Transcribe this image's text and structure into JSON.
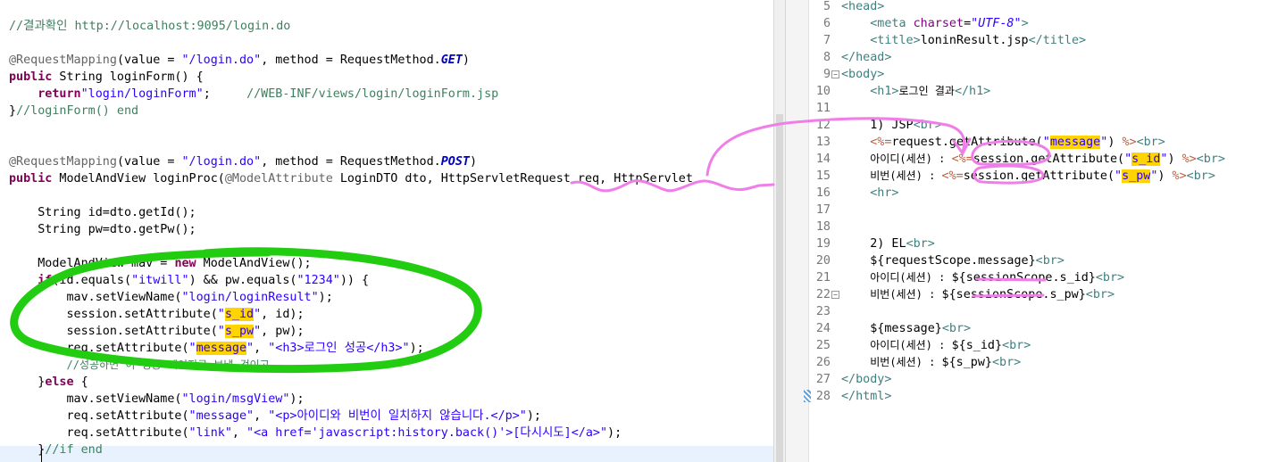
{
  "left_editor": {
    "lines": [
      {
        "t": 20,
        "segments": [
          {
            "c": "cm",
            "text": "//결과확인 http://localhost:9095/login.do"
          }
        ]
      },
      {
        "t": 58,
        "segments": [
          {
            "c": "an",
            "text": "@RequestMapping"
          },
          {
            "c": "",
            "text": "(value = "
          },
          {
            "c": "st",
            "text": "\"/login.do\""
          },
          {
            "c": "",
            "text": ", method = RequestMethod."
          },
          {
            "c": "it",
            "text": "GET"
          },
          {
            "c": "",
            "text": ")"
          }
        ]
      },
      {
        "t": 77,
        "segments": [
          {
            "c": "kw",
            "text": "public"
          },
          {
            "c": "",
            "text": " String loginForm() {"
          }
        ]
      },
      {
        "t": 96,
        "segments": [
          {
            "c": "",
            "text": "    "
          },
          {
            "c": "kw",
            "text": "return"
          },
          {
            "c": "st",
            "text": "\"login/loginForm\""
          },
          {
            "c": "",
            "text": ";     "
          },
          {
            "c": "cm",
            "text": "//WEB-INF/views/login/loginForm.jsp"
          }
        ]
      },
      {
        "t": 115,
        "segments": [
          {
            "c": "",
            "text": "}"
          },
          {
            "c": "cm",
            "text": "//loginForm() end"
          }
        ]
      },
      {
        "t": 172,
        "segments": [
          {
            "c": "an",
            "text": "@RequestMapping"
          },
          {
            "c": "",
            "text": "(value = "
          },
          {
            "c": "st",
            "text": "\"/login.do\""
          },
          {
            "c": "",
            "text": ", method = RequestMethod."
          },
          {
            "c": "it",
            "text": "POST"
          },
          {
            "c": "",
            "text": ")"
          }
        ]
      },
      {
        "t": 191,
        "segments": [
          {
            "c": "kw",
            "text": "public"
          },
          {
            "c": "",
            "text": " ModelAndView loginProc("
          },
          {
            "c": "an",
            "text": "@ModelAttribute"
          },
          {
            "c": "",
            "text": " LoginDTO dto, HttpServletRequest req, HttpServlet"
          }
        ]
      },
      {
        "t": 229,
        "segments": [
          {
            "c": "",
            "text": "    String id=dto.getId();"
          }
        ]
      },
      {
        "t": 248,
        "segments": [
          {
            "c": "",
            "text": "    String pw=dto.getPw();"
          }
        ]
      },
      {
        "t": 286,
        "segments": [
          {
            "c": "",
            "text": "    ModelAndView mav = "
          },
          {
            "c": "kw",
            "text": "new"
          },
          {
            "c": "",
            "text": " ModelAndView();"
          }
        ]
      },
      {
        "t": 305,
        "segments": [
          {
            "c": "",
            "text": "    "
          },
          {
            "c": "kw",
            "text": "if"
          },
          {
            "c": "",
            "text": "(id.equals("
          },
          {
            "c": "st",
            "text": "\"itwill\""
          },
          {
            "c": "",
            "text": ") && pw.equals("
          },
          {
            "c": "st",
            "text": "\"1234\""
          },
          {
            "c": "",
            "text": ")) {"
          }
        ]
      },
      {
        "t": 324,
        "segments": [
          {
            "c": "",
            "text": "        mav.setViewName("
          },
          {
            "c": "st",
            "text": "\"login/loginResult\""
          },
          {
            "c": "",
            "text": ");"
          }
        ]
      },
      {
        "t": 343,
        "segments": [
          {
            "c": "",
            "text": "        session.setAttribute("
          },
          {
            "c": "st",
            "text": "\""
          },
          {
            "c": "st hl",
            "text": "s_id"
          },
          {
            "c": "st",
            "text": "\""
          },
          {
            "c": "",
            "text": ", id);"
          }
        ]
      },
      {
        "t": 362,
        "segments": [
          {
            "c": "",
            "text": "        session.setAttribute("
          },
          {
            "c": "st",
            "text": "\""
          },
          {
            "c": "st hl",
            "text": "s_pw"
          },
          {
            "c": "st",
            "text": "\""
          },
          {
            "c": "",
            "text": ", pw);"
          }
        ]
      },
      {
        "t": 381,
        "segments": [
          {
            "c": "",
            "text": "        req.setAttribute("
          },
          {
            "c": "st",
            "text": "\""
          },
          {
            "c": "st hl",
            "text": "message"
          },
          {
            "c": "st",
            "text": "\""
          },
          {
            "c": "",
            "text": ", "
          },
          {
            "c": "st",
            "text": "\"<h3>로그인 성공</h3>\""
          },
          {
            "c": "",
            "text": ");"
          }
        ]
      },
      {
        "t": 400,
        "segments": [
          {
            "c": "",
            "text": "        "
          },
          {
            "c": "cm sm",
            "text": "//성공하면 이 성공 페이지로 보낼 것이고"
          }
        ]
      },
      {
        "t": 419,
        "segments": [
          {
            "c": "",
            "text": "    }"
          },
          {
            "c": "kw",
            "text": "else"
          },
          {
            "c": "",
            "text": " {"
          }
        ]
      },
      {
        "t": 438,
        "segments": [
          {
            "c": "",
            "text": "        mav.setViewName("
          },
          {
            "c": "st",
            "text": "\"login/msgView\""
          },
          {
            "c": "",
            "text": ");"
          }
        ]
      },
      {
        "t": 457,
        "segments": [
          {
            "c": "",
            "text": "        req.setAttribute("
          },
          {
            "c": "st",
            "text": "\"message\""
          },
          {
            "c": "",
            "text": ", "
          },
          {
            "c": "st",
            "text": "\"<p>아이디와 비번이 일치하지 않습니다.</p>\""
          },
          {
            "c": "",
            "text": ");"
          }
        ]
      },
      {
        "t": 476,
        "segments": [
          {
            "c": "",
            "text": "        req.setAttribute("
          },
          {
            "c": "st",
            "text": "\"link\""
          },
          {
            "c": "",
            "text": ", "
          },
          {
            "c": "st",
            "text": "\"<a href='javascript:history.back()'>[다시시도]</a>\""
          },
          {
            "c": "",
            "text": ");"
          }
        ]
      },
      {
        "t": 495,
        "segments": [
          {
            "c": "",
            "text": "    }"
          },
          {
            "c": "cm",
            "text": "//if end"
          }
        ]
      }
    ]
  },
  "right_editor": {
    "lines": [
      {
        "n": "5",
        "t": -2,
        "segments": [
          {
            "c": "tg",
            "text": "<head>"
          }
        ]
      },
      {
        "n": "6",
        "t": 17,
        "segments": [
          {
            "c": "",
            "text": "    "
          },
          {
            "c": "tg",
            "text": "<meta "
          },
          {
            "c": "at",
            "text": "charset"
          },
          {
            "c": "",
            "text": "="
          },
          {
            "c": "av",
            "text": "\"UTF-8\""
          },
          {
            "c": "tg",
            "text": ">"
          }
        ]
      },
      {
        "n": "7",
        "t": 36,
        "segments": [
          {
            "c": "",
            "text": "    "
          },
          {
            "c": "tg",
            "text": "<title>"
          },
          {
            "c": "",
            "text": "loninResult.jsp"
          },
          {
            "c": "tg",
            "text": "</title>"
          }
        ]
      },
      {
        "n": "8",
        "t": 55,
        "segments": [
          {
            "c": "tg",
            "text": "</head>"
          }
        ]
      },
      {
        "n": "9",
        "t": 74,
        "fold": true,
        "segments": [
          {
            "c": "tg",
            "text": "<body>"
          }
        ]
      },
      {
        "n": "10",
        "t": 93,
        "segments": [
          {
            "c": "",
            "text": "    "
          },
          {
            "c": "tg",
            "text": "<h1>"
          },
          {
            "c": "sm",
            "text": "로그인 결과"
          },
          {
            "c": "tg",
            "text": "</h1>"
          }
        ]
      },
      {
        "n": "11",
        "t": 112,
        "segments": []
      },
      {
        "n": "12",
        "t": 131,
        "segments": [
          {
            "c": "",
            "text": "    1) JSP"
          },
          {
            "c": "tg",
            "text": "<br>"
          }
        ]
      },
      {
        "n": "13",
        "t": 150,
        "segments": [
          {
            "c": "",
            "text": "    "
          },
          {
            "c": "jsp",
            "text": "<%="
          },
          {
            "c": "",
            "text": "request.getAttribute("
          },
          {
            "c": "st",
            "text": "\""
          },
          {
            "c": "st hl",
            "text": "message"
          },
          {
            "c": "st",
            "text": "\""
          },
          {
            "c": "",
            "text": ") "
          },
          {
            "c": "jsp",
            "text": "%>"
          },
          {
            "c": "tg",
            "text": "<br>"
          }
        ]
      },
      {
        "n": "14",
        "t": 169,
        "segments": [
          {
            "c": "",
            "text": "    "
          },
          {
            "c": "sm",
            "text": "아이디(세션) : "
          },
          {
            "c": "jsp",
            "text": "<%="
          },
          {
            "c": "",
            "text": "session.getAttribute("
          },
          {
            "c": "st",
            "text": "\""
          },
          {
            "c": "st hl",
            "text": "s_id"
          },
          {
            "c": "st",
            "text": "\""
          },
          {
            "c": "",
            "text": ") "
          },
          {
            "c": "jsp",
            "text": "%>"
          },
          {
            "c": "tg",
            "text": "<br>"
          }
        ]
      },
      {
        "n": "15",
        "t": 188,
        "segments": [
          {
            "c": "",
            "text": "    "
          },
          {
            "c": "sm",
            "text": "비번(세션) : "
          },
          {
            "c": "jsp",
            "text": "<%="
          },
          {
            "c": "",
            "text": "session.getAttribute("
          },
          {
            "c": "st",
            "text": "\""
          },
          {
            "c": "st hl",
            "text": "s_pw"
          },
          {
            "c": "st",
            "text": "\""
          },
          {
            "c": "",
            "text": ") "
          },
          {
            "c": "jsp",
            "text": "%>"
          },
          {
            "c": "tg",
            "text": "<br>"
          }
        ]
      },
      {
        "n": "16",
        "t": 207,
        "segments": [
          {
            "c": "",
            "text": "    "
          },
          {
            "c": "tg",
            "text": "<hr>"
          }
        ]
      },
      {
        "n": "17",
        "t": 226,
        "segments": []
      },
      {
        "n": "18",
        "t": 245,
        "segments": []
      },
      {
        "n": "19",
        "t": 264,
        "segments": [
          {
            "c": "",
            "text": "    2) EL"
          },
          {
            "c": "tg",
            "text": "<br>"
          }
        ]
      },
      {
        "n": "20",
        "t": 283,
        "segments": [
          {
            "c": "",
            "text": "    ${requestScope.message}"
          },
          {
            "c": "tg",
            "text": "<br>"
          }
        ]
      },
      {
        "n": "21",
        "t": 302,
        "segments": [
          {
            "c": "",
            "text": "    "
          },
          {
            "c": "sm",
            "text": "아이디(세션) : "
          },
          {
            "c": "",
            "text": "${sessionScope.s_id}"
          },
          {
            "c": "tg",
            "text": "<br>"
          }
        ]
      },
      {
        "n": "22",
        "t": 321,
        "fold": true,
        "segments": [
          {
            "c": "",
            "text": "    "
          },
          {
            "c": "sm",
            "text": "비번(세션) : "
          },
          {
            "c": "",
            "text": "${sessionScope.s_pw}"
          },
          {
            "c": "tg",
            "text": "<br>"
          }
        ]
      },
      {
        "n": "23",
        "t": 340,
        "segments": []
      },
      {
        "n": "24",
        "t": 359,
        "segments": [
          {
            "c": "",
            "text": "    ${message}"
          },
          {
            "c": "tg",
            "text": "<br>"
          }
        ]
      },
      {
        "n": "25",
        "t": 378,
        "segments": [
          {
            "c": "",
            "text": "    "
          },
          {
            "c": "sm",
            "text": "아이디(세션) : "
          },
          {
            "c": "",
            "text": "${s_id}"
          },
          {
            "c": "tg",
            "text": "<br>"
          }
        ]
      },
      {
        "n": "26",
        "t": 397,
        "segments": [
          {
            "c": "",
            "text": "    "
          },
          {
            "c": "sm",
            "text": "비번(세션) : "
          },
          {
            "c": "",
            "text": "${s_pw}"
          },
          {
            "c": "tg",
            "text": "<br>"
          }
        ]
      },
      {
        "n": "27",
        "t": 416,
        "segments": [
          {
            "c": "tg",
            "text": "</body>"
          }
        ]
      },
      {
        "n": "28",
        "t": 435,
        "segments": [
          {
            "c": "tg",
            "text": "</html>"
          }
        ]
      }
    ]
  },
  "colors": {
    "annotation_green": "#22cc11",
    "annotation_pink": "#f07ee8",
    "highlight": "#ffd400"
  }
}
